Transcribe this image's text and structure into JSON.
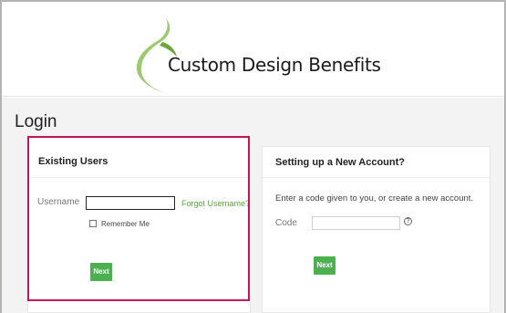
{
  "brand": {
    "name": "Custom Design Benefits",
    "logo_color": "#8cbf5a"
  },
  "page": {
    "title": "Login"
  },
  "existing_users": {
    "heading": "Existing Users",
    "username_label": "Username",
    "username_value": "",
    "forgot_username_link": "Forgot Username?",
    "remember_me_label": "Remember Me",
    "remember_me_checked": false,
    "next_button": "Next"
  },
  "new_account": {
    "heading": "Setting up a New Account?",
    "instructions": "Enter a code given to you, or create a new account.",
    "code_label": "Code",
    "code_value": "",
    "help_icon": "?",
    "next_button": "Next"
  },
  "colors": {
    "accent_green": "#4caf50",
    "link_green": "#58a83e",
    "highlight_border": "#c2185b"
  }
}
